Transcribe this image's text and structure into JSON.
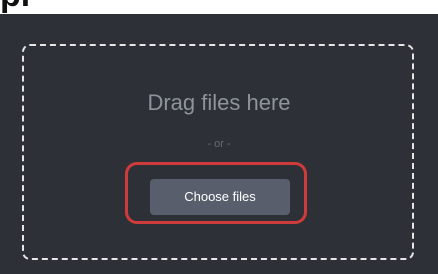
{
  "header": {
    "title_fragment": "pl"
  },
  "dropzone": {
    "drag_text": "Drag files here",
    "or_text": "- or -",
    "choose_button_label": "Choose files"
  },
  "colors": {
    "panel_background": "#2d3037",
    "dashed_border": "#e6e6e6",
    "button_background": "#585e6b",
    "highlight_ring": "#cf3b3b"
  }
}
